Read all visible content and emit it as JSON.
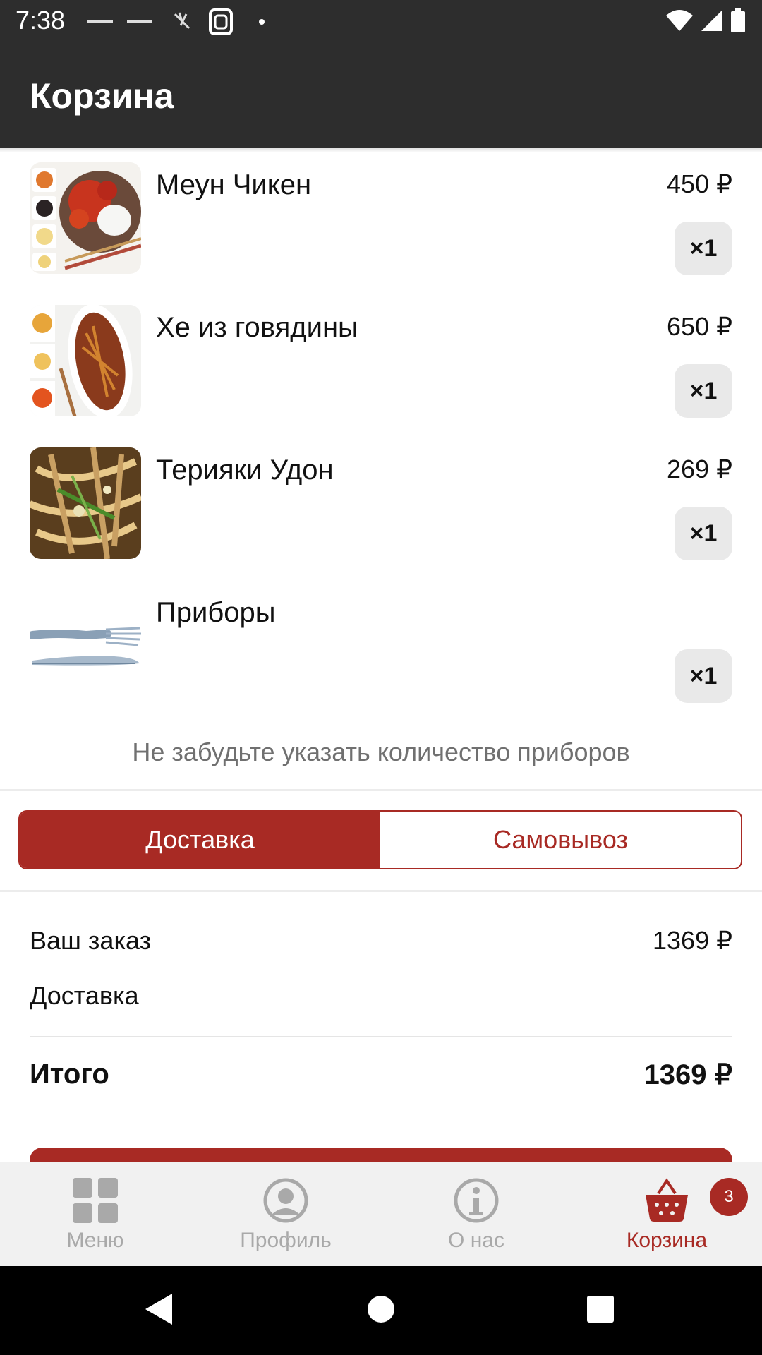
{
  "status_bar": {
    "time": "7:38"
  },
  "appbar": {
    "title": "Корзина"
  },
  "cart": {
    "items": [
      {
        "name": "Меун Чикен",
        "price": "450 ₽",
        "qty": "×1"
      },
      {
        "name": "Хе из говядины",
        "price": "650 ₽",
        "qty": "×1"
      },
      {
        "name": "Терияки Удон",
        "price": "269 ₽",
        "qty": "×1"
      },
      {
        "name": "Приборы",
        "price": "",
        "qty": "×1"
      }
    ],
    "hint": "Не забудьте указать количество приборов"
  },
  "delivery_toggle": {
    "delivery": "Доставка",
    "pickup": "Самовывоз",
    "selected": "delivery"
  },
  "summary": {
    "order_label": "Ваш заказ",
    "order_value": "1369 ₽",
    "delivery_label": "Доставка",
    "delivery_value": "",
    "total_label": "Итого",
    "total_value": "1369 ₽"
  },
  "bottom_nav": {
    "items": [
      {
        "label": "Меню",
        "icon": "grid-icon"
      },
      {
        "label": "Профиль",
        "icon": "profile-icon"
      },
      {
        "label": "О нас",
        "icon": "info-icon"
      },
      {
        "label": "Корзина",
        "icon": "basket-icon",
        "badge": "3",
        "active": true
      }
    ]
  },
  "colors": {
    "accent": "#a82a24",
    "appbar": "#2d2d2d",
    "inactive_nav": "#a9a9a9"
  }
}
